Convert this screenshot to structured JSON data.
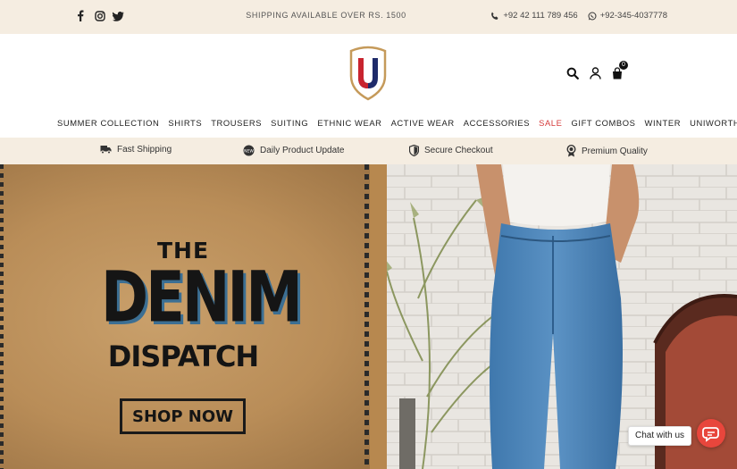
{
  "topbar": {
    "social": [
      "facebook-icon",
      "instagram-icon",
      "twitter-icon"
    ],
    "shipping_note": "SHIPPING AVAILABLE OVER RS. 1500",
    "phone": "+92 42 111 789 456",
    "whatsapp": "+92-345-4037778"
  },
  "header": {
    "logo_letter": "U",
    "cart_count": "0"
  },
  "nav": {
    "items": [
      "SUMMER COLLECTION",
      "SHIRTS",
      "TROUSERS",
      "SUITING",
      "ETHNIC WEAR",
      "ACTIVE WEAR",
      "ACCESSORIES",
      "SALE",
      "GIFT COMBOS",
      "WINTER",
      "UNIWORTH BLACK"
    ]
  },
  "features": [
    {
      "icon": "truck-icon",
      "label": "Fast Shipping"
    },
    {
      "icon": "new-badge-icon",
      "label": "Daily Product Update"
    },
    {
      "icon": "shield-icon",
      "label": "Secure Checkout"
    },
    {
      "icon": "award-icon",
      "label": "Premium Quality"
    }
  ],
  "hero": {
    "line1": "THE",
    "line2": "DENIM",
    "line3": "DISPATCH",
    "cta": "SHOP NOW"
  },
  "chat": {
    "label": "Chat with us"
  },
  "colors": {
    "cream": "#f5ede1",
    "sale": "#d53b3b",
    "chat": "#e8463c"
  }
}
